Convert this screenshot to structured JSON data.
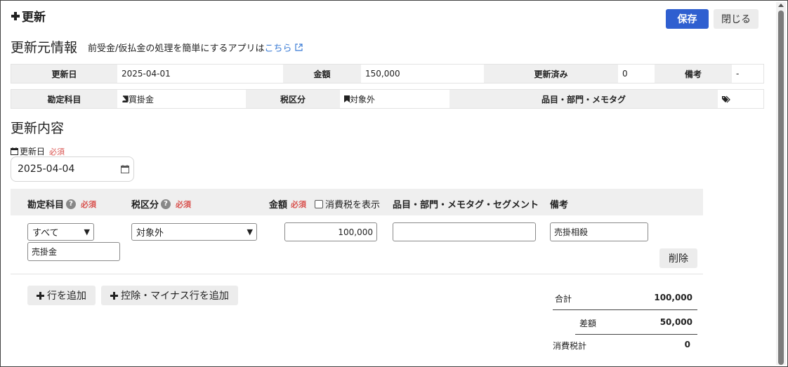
{
  "header": {
    "title": "更新",
    "save_label": "保存",
    "close_label": "閉じる"
  },
  "source": {
    "title": "更新元情報",
    "subtitle": "前受金/仮払金の処理を簡単にするアプリは",
    "link_text": "こちら",
    "row1": [
      {
        "label": "更新日",
        "value": "2025-04-01"
      },
      {
        "label": "金額",
        "value": "150,000"
      },
      {
        "label": "更新済み",
        "value": "0"
      },
      {
        "label": "備考",
        "value": "-"
      }
    ],
    "row2": [
      {
        "label": "勘定科目",
        "value": "買掛金",
        "icon": "book-icon"
      },
      {
        "label": "税区分",
        "value": "対象外",
        "icon": "bookmark-icon"
      },
      {
        "label": "品目・部門・メモタグ",
        "value": "",
        "icon": "tags-icon"
      }
    ]
  },
  "content": {
    "title": "更新内容",
    "date_label": "更新日",
    "required": "必須",
    "date_value": "2025-04-04",
    "headers": {
      "account": "勘定科目",
      "tax": "税区分",
      "amount": "金額",
      "show_tax": "消費税を表示",
      "segment": "品目・部門・メモタグ・セグメント",
      "note": "備考"
    },
    "row": {
      "account_filter": "すべて",
      "account_value": "売掛金",
      "tax_value": "対象外",
      "amount": "100,000",
      "segment": "",
      "note": "売掛相殺",
      "delete_label": "削除"
    },
    "add_row_label": "行を追加",
    "add_minus_row_label": "控除・マイナス行を追加"
  },
  "totals": {
    "total_label": "合計",
    "total_value": "100,000",
    "diff_label": "差額",
    "diff_value": "50,000",
    "tax_label": "消費税計",
    "tax_value": "0"
  },
  "colors": {
    "primary": "#2f5fd0",
    "required": "#d9534f",
    "link": "#3a7bd5"
  }
}
